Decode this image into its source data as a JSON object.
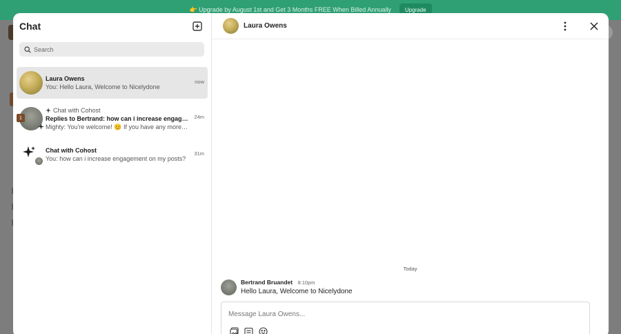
{
  "banner": {
    "text": "👉 Upgrade by August 1st and Get 3 Months FREE When Billed Annually",
    "button": "Upgrade"
  },
  "chat": {
    "title": "Chat",
    "search_placeholder": "Search",
    "conversations": [
      {
        "name": "Laura Owens",
        "preview": "You: Hello Laura, Welcome to Nicelydone",
        "time": "now",
        "active": true
      },
      {
        "context": "Chat with Cohost",
        "name": "Replies to Bertrand: how can i increase engagement on my posts?",
        "preview": "Mighty: You're welcome! 😊 If you have any more questions, feel free to ask.",
        "time": "24m",
        "unread": "1"
      },
      {
        "name": "Chat with Cohost",
        "preview": "You: how can i increase engagement on my posts?",
        "time": "31m"
      }
    ]
  },
  "thread": {
    "contact_name": "Laura Owens",
    "day_separator": "Today",
    "messages": [
      {
        "author": "Bertrand Bruandet",
        "time": "8:10pm",
        "text": "Hello Laura, Welcome to Nicelydone"
      }
    ],
    "composer_placeholder": "Message Laura Owens..."
  },
  "colors": {
    "banner_bg": "#2f9f74",
    "overlay": "#7b7b7b",
    "active_row": "#e6e6e6",
    "badge": "#7a4a2a"
  }
}
